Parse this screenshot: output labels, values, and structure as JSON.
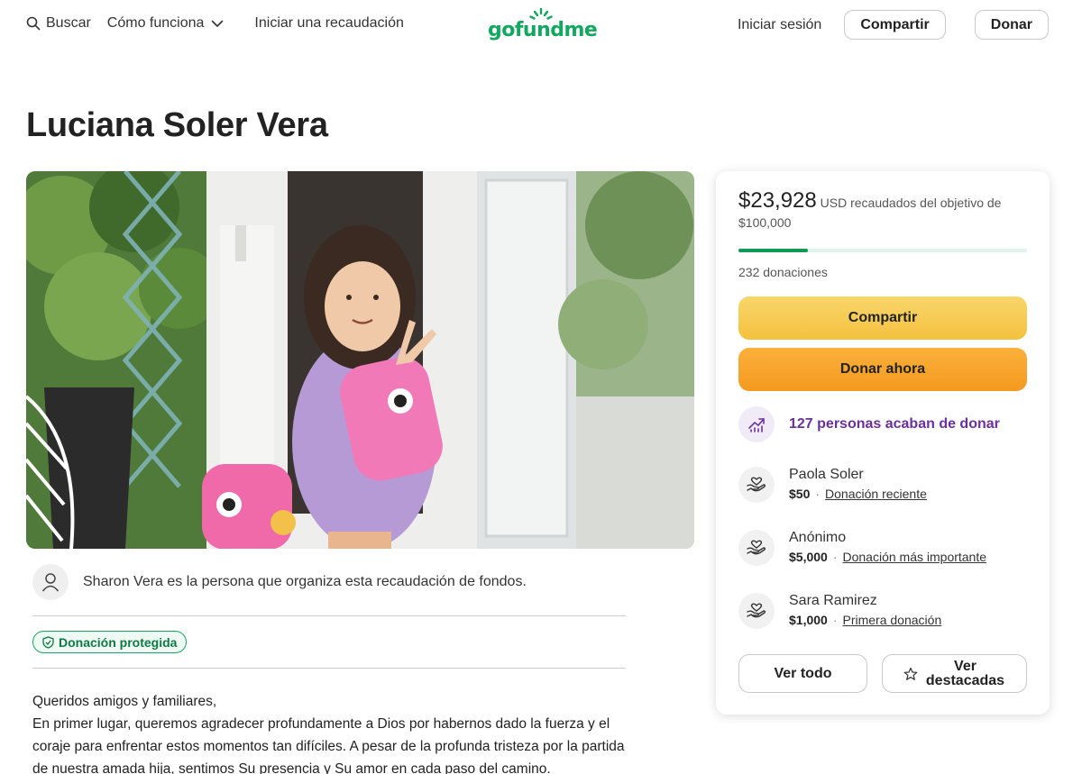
{
  "header": {
    "search_label": "Buscar",
    "how_label": "Cómo funciona",
    "start_label": "Iniciar una recaudación",
    "logo_text": "gofundme",
    "login_label": "Iniciar sesión",
    "share_label": "Compartir",
    "donate_label": "Donar"
  },
  "campaign": {
    "title": "Luciana Soler Vera",
    "organizer_text": "Sharon Vera es la persona que organiza esta recaudación de fondos.",
    "protected_badge": "Donación protegida",
    "story": [
      "Queridos amigos y familiares,",
      "En primer lugar, queremos agradecer profundamente a Dios por habernos dado la fuerza y el coraje para enfrentar estos momentos tan difíciles. A pesar de la profunda tristeza por la partida de nuestra amada hija, sentimos Su presencia y Su amor en cada paso del camino."
    ]
  },
  "card": {
    "raised_amount": "$23,928",
    "raised_text": "USD recaudados del objetivo de $100,000",
    "progress_fraction": 0.24,
    "donations_count": "232 donaciones",
    "share_label": "Compartir",
    "donate_now_label": "Donar ahora",
    "trend_label": "127 personas acaban de donar",
    "donors": [
      {
        "name": "Paola Soler",
        "amount": "$50",
        "tag": "Donación reciente"
      },
      {
        "name": "Anónimo",
        "amount": "$5,000",
        "tag": "Donación más importante"
      },
      {
        "name": "Sara Ramirez",
        "amount": "$1,000",
        "tag": "Primera donación"
      }
    ],
    "see_all_label": "Ver todo",
    "see_top_label": "Ver destacadas"
  },
  "colors": {
    "brand_green": "#12a85f",
    "progress": "#0f9a55",
    "share_button": "#f6cb53",
    "donate_button": "#f7a52b",
    "trend_purple": "#6b2fa0"
  },
  "icons": [
    "search-icon",
    "chevron-down-icon",
    "user-icon",
    "shield-icon",
    "trending-icon",
    "donor-hands-icon",
    "star-icon"
  ]
}
